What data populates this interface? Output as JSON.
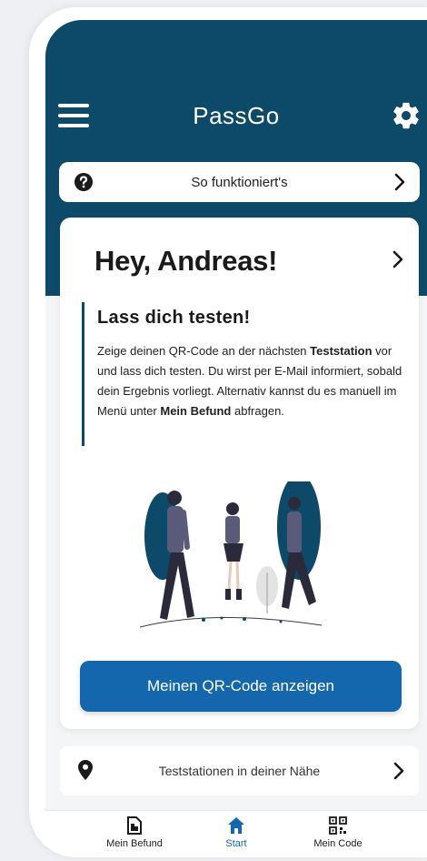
{
  "app": {
    "title": "PassGo"
  },
  "help": {
    "label": "So funktioniert's"
  },
  "card": {
    "greeting": "Hey, Andreas!",
    "info_title": "Lass dich testen!",
    "info_text": {
      "part1": "Zeige deinen QR-Code an der nächsten ",
      "bold1": "Teststation",
      "part2": " vor und lass dich testen. Du wirst per E-Mail informiert, sobald dein Ergebnis vorliegt. Alternativ kannst du es manuell im Menü unter ",
      "bold2": "Mein Befund",
      "part3": " abfragen."
    },
    "qr_button": "Meinen QR-Code anzeigen"
  },
  "stations": {
    "label": "Teststationen in deiner Nähe"
  },
  "tabs": [
    {
      "label": "Mein Befund",
      "icon": "document-icon"
    },
    {
      "label": "Start",
      "icon": "home-icon",
      "active": true
    },
    {
      "label": "Mein Code",
      "icon": "qr-code-icon"
    }
  ],
  "colors": {
    "header": "#0d4a6a",
    "accent": "#1467ac",
    "background": "#f4f5f7"
  }
}
